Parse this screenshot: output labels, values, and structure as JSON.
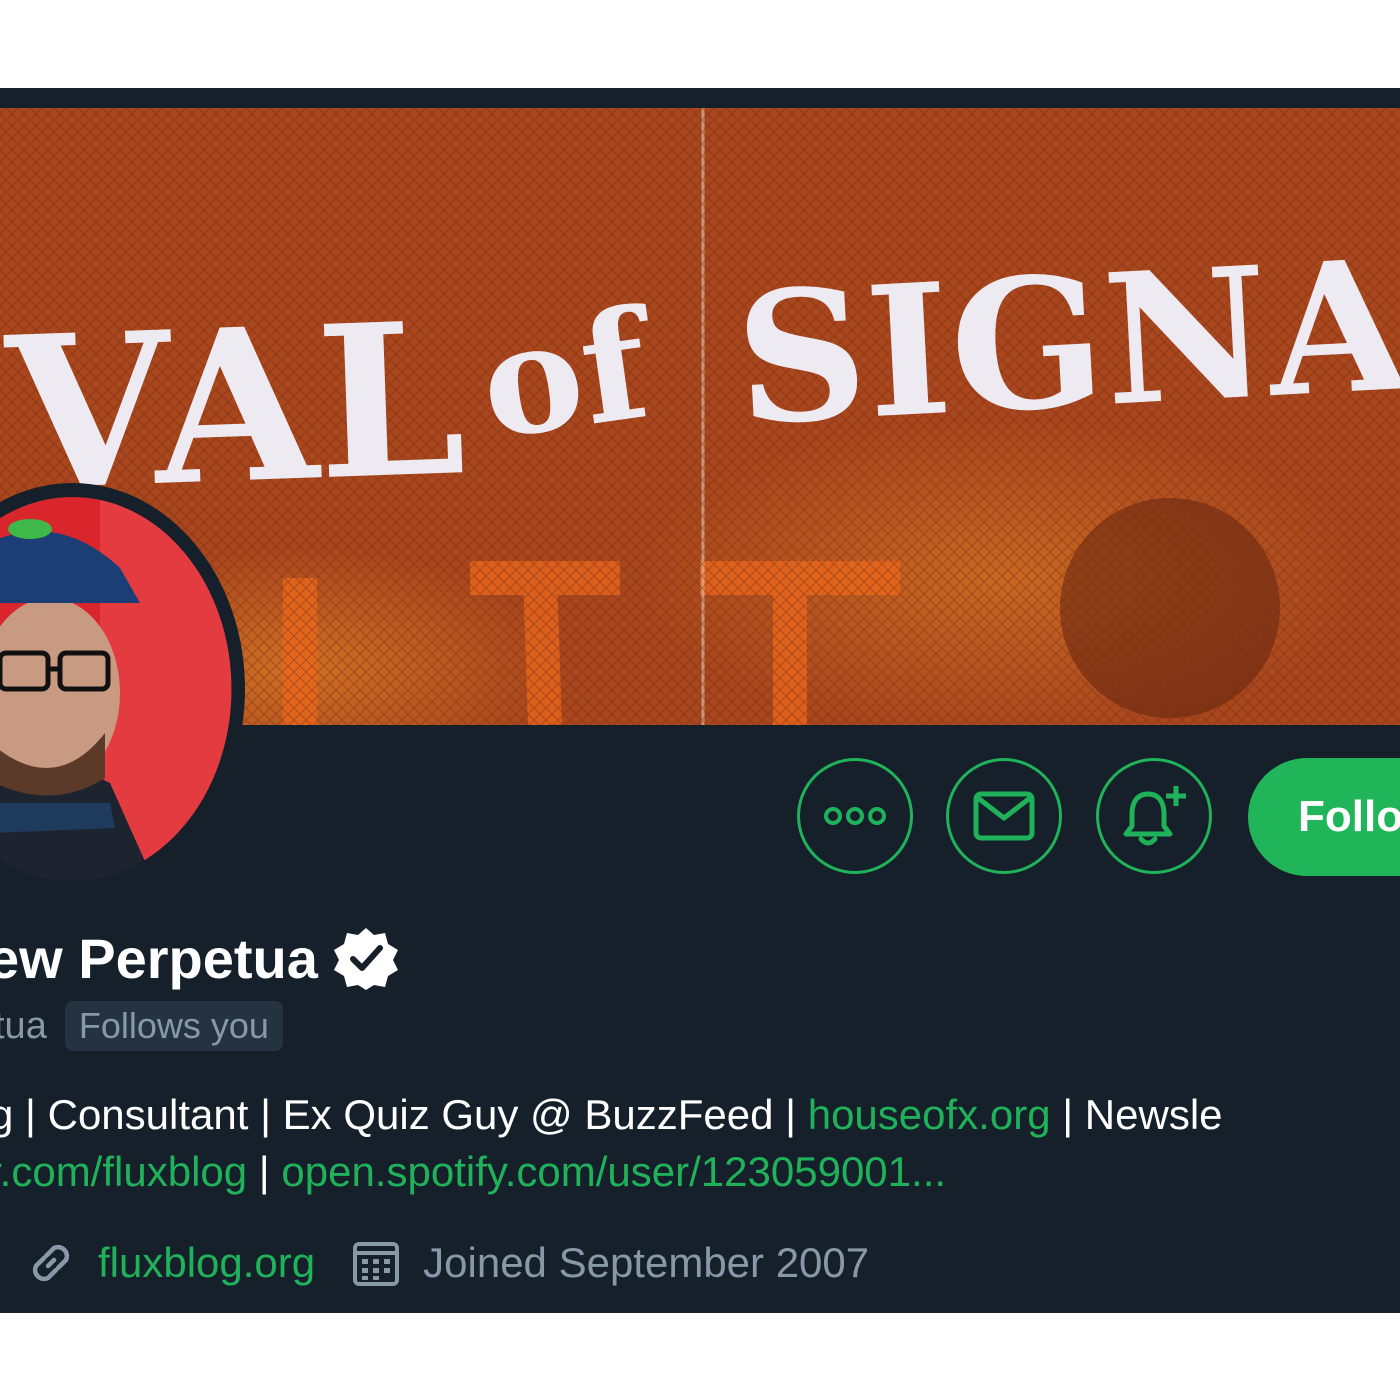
{
  "profile": {
    "display_name": "ew Perpetua",
    "handle": "tua",
    "follows_you": "Follows you",
    "verified": true
  },
  "actions": {
    "more_icon": "more-horizontal-icon",
    "message_icon": "envelope-icon",
    "notify_icon": "bell-plus-icon",
    "follow_label": "Follo"
  },
  "bio": {
    "line1_prefix": "g | Consultant | Ex Quiz Guy @ BuzzFeed | ",
    "line1_link": "houseofx.org",
    "line1_suffix": " | Newsle",
    "line2_link1": "r.com/fluxblog",
    "line2_sep": " | ",
    "line2_link2": "open.spotify.com/user/123059001..."
  },
  "meta": {
    "website": "fluxblog.org",
    "joined": "Joined September 2007"
  },
  "banner": {
    "text_fragment_1": "VAL",
    "text_fragment_2": "of",
    "text_fragment_3": "SIGNA"
  },
  "colors": {
    "background": "#15202b",
    "accent": "#1fb25a",
    "muted_text": "#8899a6",
    "banner_rust": "#a8421a"
  }
}
